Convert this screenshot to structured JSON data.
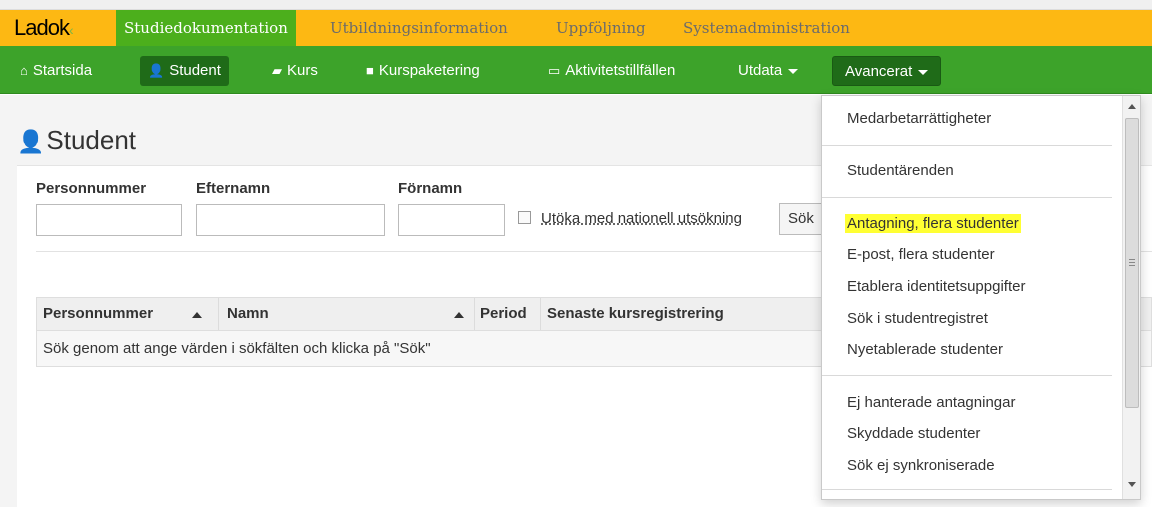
{
  "logo": {
    "text": "Ladok"
  },
  "top_tabs": [
    {
      "label": "Studiedokumentation",
      "active": true
    },
    {
      "label": "Utbildningsinformation",
      "active": false
    },
    {
      "label": "Uppföljning",
      "active": false
    },
    {
      "label": "Systemadministration",
      "active": false
    }
  ],
  "nav": [
    {
      "label": "Startsida",
      "icon": "home-icon"
    },
    {
      "label": "Student",
      "icon": "user-icon",
      "active": true
    },
    {
      "label": "Kurs",
      "icon": "book-icon"
    },
    {
      "label": "Kurspaketering",
      "icon": "folder-icon"
    },
    {
      "label": "Aktivitetstillfällen",
      "icon": "calendar-icon"
    },
    {
      "label": "Utdata",
      "icon": "caret-down-icon"
    },
    {
      "label": "Avancerat",
      "icon": "caret-down-icon",
      "open": true
    }
  ],
  "page": {
    "title": "Student",
    "title_icon": "user-icon"
  },
  "form": {
    "personnummer_label": "Personnummer",
    "efternamn_label": "Efternamn",
    "fornamn_label": "Förnamn",
    "personnummer_value": "",
    "efternamn_value": "",
    "fornamn_value": "",
    "national_search_label": "Utöka med nationell utsökning",
    "national_search_checked": false,
    "search_button": "Sök"
  },
  "table": {
    "headers": [
      "Personnummer",
      "Namn",
      "Period",
      "Senaste kursregistrering"
    ],
    "empty_message": "Sök genom att ange värden i sökfälten och klicka på \"Sök\""
  },
  "dropdown": {
    "groups": [
      [
        "Medarbetarrättigheter"
      ],
      [
        "Studentärenden"
      ],
      [
        "Antagning, flera studenter",
        "E-post, flera studenter",
        "Etablera identitetsuppgifter",
        "Sök i studentregistret",
        "Nyetablerade studenter"
      ],
      [
        "Ej hanterade antagningar",
        "Skyddade studenter",
        "Sök ej synkroniserade"
      ]
    ],
    "highlighted": "Antagning, flera studenter",
    "highlight_color": "#ffff33"
  },
  "colors": {
    "topbar": "#fdb813",
    "navbar": "#3da32a",
    "active_tab": "#4caf1c",
    "nav_active": "#1f6b18"
  }
}
